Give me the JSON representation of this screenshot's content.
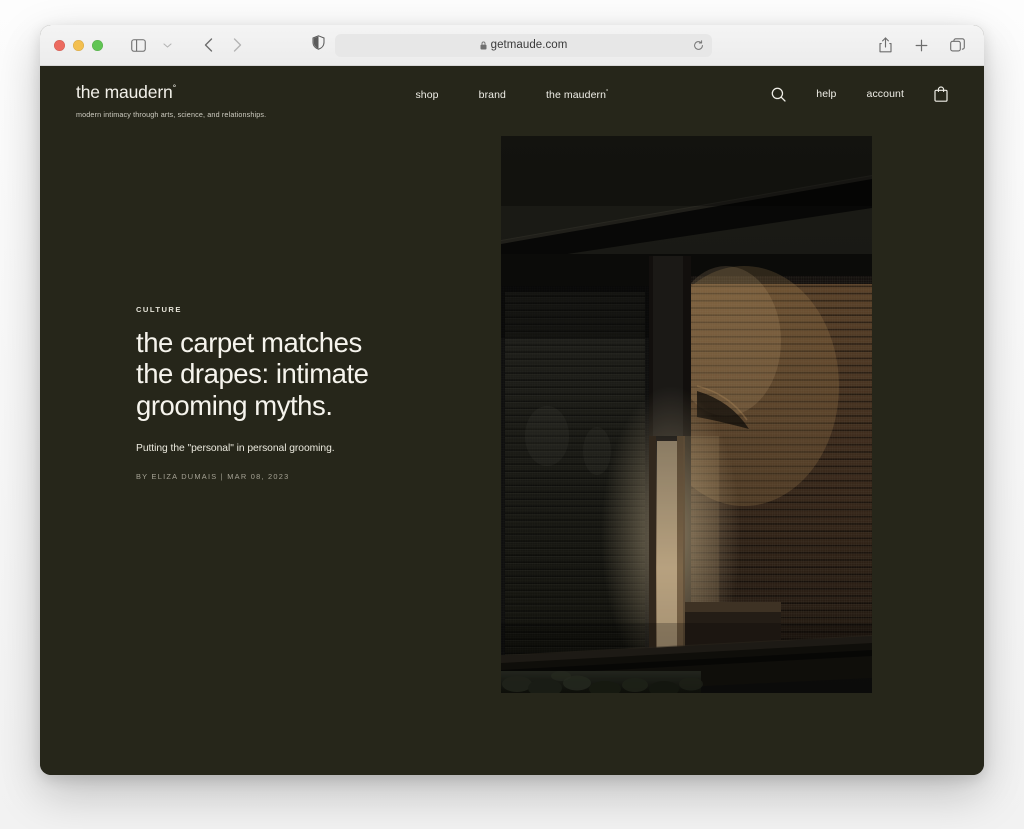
{
  "browser": {
    "window_controls": [
      {
        "name": "close",
        "color": "#ec6a5f"
      },
      {
        "name": "minimize",
        "color": "#f3bf4f"
      },
      {
        "name": "maximize",
        "color": "#61c554"
      }
    ],
    "sidebar_toggle_label": "Show sidebar",
    "tab_overview_chevron_label": "Tab group options",
    "back_label": "Back",
    "forward_label": "Forward",
    "reader_label": "Reader view",
    "url": "getmaude.com",
    "lock_label": "Secure connection",
    "reload_label": "Reload page",
    "share_label": "Share",
    "new_tab_label": "New tab",
    "tabs_overview_label": "Show all tabs"
  },
  "site": {
    "brand": {
      "logo": "the maudern",
      "logo_mark": "°",
      "tagline": "modern intimacy through arts, science, and relationships."
    },
    "nav_center": [
      {
        "label": "shop",
        "mark": ""
      },
      {
        "label": "brand",
        "mark": ""
      },
      {
        "label": "the maudern",
        "mark": "°"
      }
    ],
    "nav_right": {
      "search_label": "Search",
      "help_label": "help",
      "account_label": "account",
      "cart_label": "Cart"
    },
    "hero": {
      "eyebrow": "CULTURE",
      "headline": "the carpet matches the drapes: intimate grooming myths.",
      "dek": "Putting the \"personal\" in personal grooming.",
      "byline": "BY ELIZA DUMAIS | MAR 08, 2023",
      "photo_alt": "Night view through a window with venetian blinds lit by warm interior light, stones along the sill."
    }
  },
  "colors": {
    "page_background": "#26261a",
    "chrome_background": "#f0f0f0",
    "text_primary": "#f6f4ed",
    "text_muted": "#a5a294",
    "url_field": "#e7e7e7"
  }
}
